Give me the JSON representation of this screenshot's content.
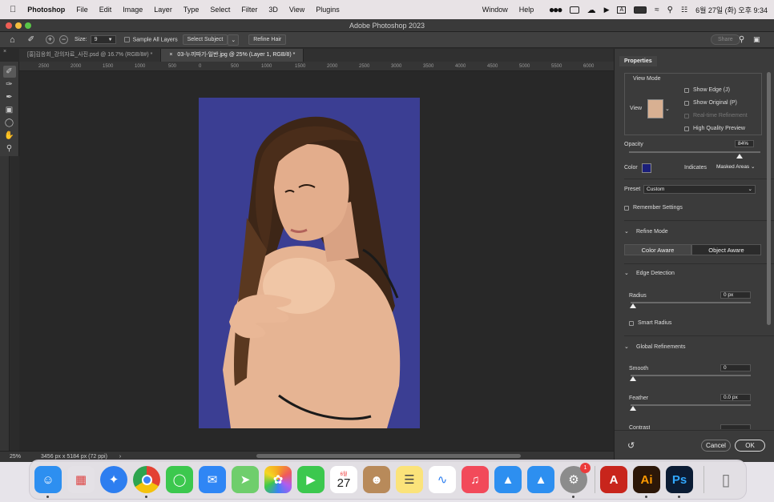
{
  "menubar": {
    "apple_icon": "apple-icon",
    "app_name": "Photoshop",
    "items": [
      "File",
      "Edit",
      "Image",
      "Layer",
      "Type",
      "Select",
      "Filter",
      "3D",
      "View",
      "Plugins",
      "Window",
      "Help"
    ],
    "datetime": "6월 27일 (화) 오후 9:34"
  },
  "window": {
    "title": "Adobe Photoshop 2023"
  },
  "options": {
    "size_label": "Size:",
    "size_value": "9",
    "sample_all_layers": "Sample All Layers",
    "select_subject": "Select Subject",
    "refine_hair": "Refine Hair",
    "share": "Share"
  },
  "tabs": [
    {
      "label": "[홍]김응회_강의자료_사진.psd @ 16.7% (RGB/8#) *"
    },
    {
      "label": "03-누끼따기-일반.jpg @ 25% (Layer 1, RGB/8) *"
    }
  ],
  "ruler": {
    "ticks": [
      "2500",
      "2000",
      "1500",
      "1000",
      "500",
      "0",
      "500",
      "1000",
      "1500",
      "2000",
      "2500",
      "3000",
      "3500",
      "4000",
      "4500",
      "5000",
      "5500",
      "6000"
    ]
  },
  "status": {
    "zoom": "25%",
    "doc_info": "3456 px x 5184 px (72 ppi)"
  },
  "properties": {
    "tab": "Properties",
    "view_mode": "View Mode",
    "view_label": "View",
    "show_edge": "Show Edge (J)",
    "show_original": "Show Original (P)",
    "realtime": "Real-time Refinement",
    "high_quality": "High Quality Preview",
    "opacity_label": "Opacity",
    "opacity_value": "84%",
    "opacity_fraction": 0.84,
    "color_label": "Color",
    "color_swatch": "#1b1f7a",
    "indicates_label": "Indicates",
    "indicates_value": "Masked Areas",
    "preset_label": "Preset",
    "preset_value": "Custom",
    "remember": "Remember Settings",
    "refine_mode": "Refine Mode",
    "color_aware": "Color Aware",
    "object_aware": "Object Aware",
    "edge_detection": "Edge Detection",
    "radius_label": "Radius",
    "radius_value": "0 px",
    "smart_radius": "Smart Radius",
    "global_refinements": "Global Refinements",
    "smooth_label": "Smooth",
    "smooth_value": "0",
    "feather_label": "Feather",
    "feather_value": "0.0 px",
    "contrast_label": "Contrast",
    "cancel": "Cancel",
    "ok": "OK"
  },
  "dock": {
    "calendar_month": "6월",
    "calendar_day": "27",
    "settings_badge": "1",
    "acrobat": "A",
    "illustrator": "Ai",
    "photoshop": "Ps"
  },
  "colors": {
    "backdrop": "#3b3e93",
    "accent": "#ffffff"
  }
}
